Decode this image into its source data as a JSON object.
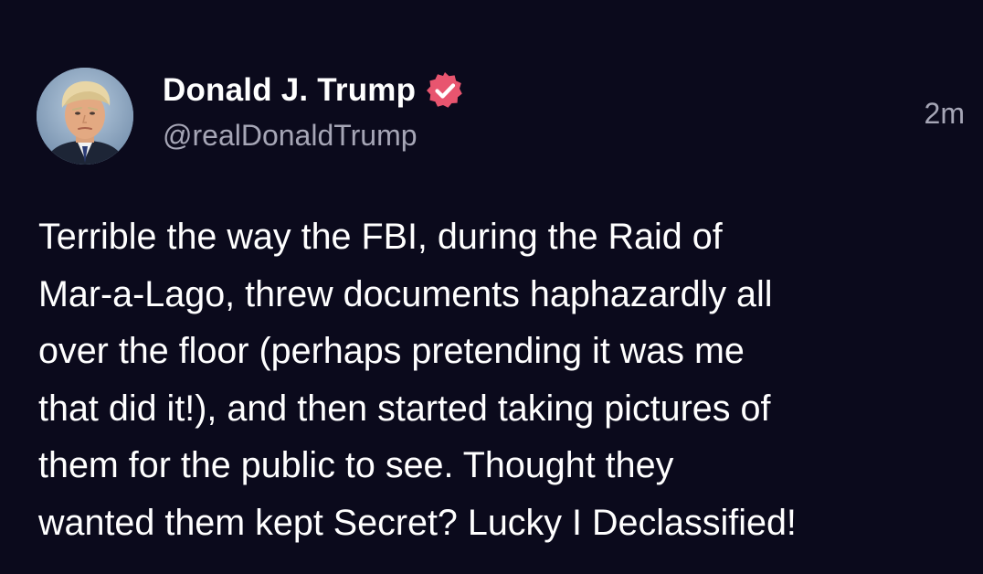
{
  "post": {
    "author": {
      "display_name": "Donald J. Trump",
      "handle": "@realDonaldTrump",
      "verified": true,
      "verified_badge_color": "#e8556f",
      "avatar": "profile-photo"
    },
    "timestamp": "2m",
    "body_lines": [
      "Terrible the way the FBI, during the Raid of",
      "Mar-a-Lago, threw documents haphazardly all",
      "over the floor (perhaps pretending it was me",
      "that did it!), and then started taking pictures of",
      "them for the public to see. Thought they",
      "wanted them kept Secret? Lucky I Declassified!"
    ]
  },
  "colors": {
    "background": "#0b0a1c",
    "text_primary": "#ffffff",
    "text_secondary": "#a6a6b6"
  }
}
